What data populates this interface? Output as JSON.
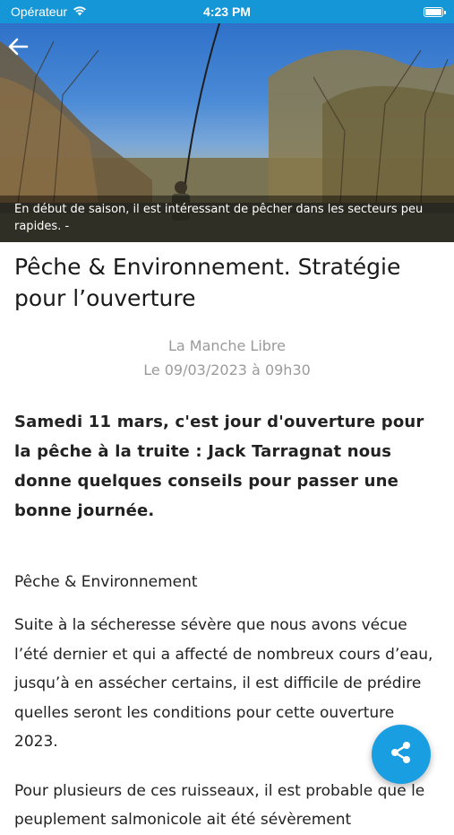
{
  "status_bar": {
    "carrier": "Opérateur",
    "time": "4:23 PM",
    "wifi_icon": "wifi-icon",
    "battery_icon": "battery-icon"
  },
  "hero": {
    "back_icon": "arrow-left-icon",
    "caption": "En début de saison, il est intéressant de pêcher dans les secteurs peu rapides. -"
  },
  "article": {
    "title": "Pêche & Environnement. Stratégie pour l’ouverture",
    "source": "La Manche Libre",
    "date": "Le 09/03/2023 à 09h30",
    "lead": "Samedi 11 mars, c'est jour d'ouverture pour la pêche à la truite : Jack Tarragnat nous donne quelques conseils pour passer une bonne journée.",
    "section": "Pêche & Environnement",
    "paragraph1": "Suite à la sécheresse sévère que nous avons vécue l’été dernier et qui a affecté de nombreux cours d’eau, jusqu’à en assécher certains, il est difficile de prédire quelles seront les conditions pour cette ouverture 2023.",
    "paragraph2": "Pour plusieurs de ces ruisseaux, il est probable que le peuplement salmonicole ait été sévèrement"
  },
  "fab": {
    "icon": "share-icon"
  },
  "colors": {
    "status_bar": "#1596d6",
    "fab": "#1a9ee2",
    "meta_text": "#9a9a9a"
  }
}
